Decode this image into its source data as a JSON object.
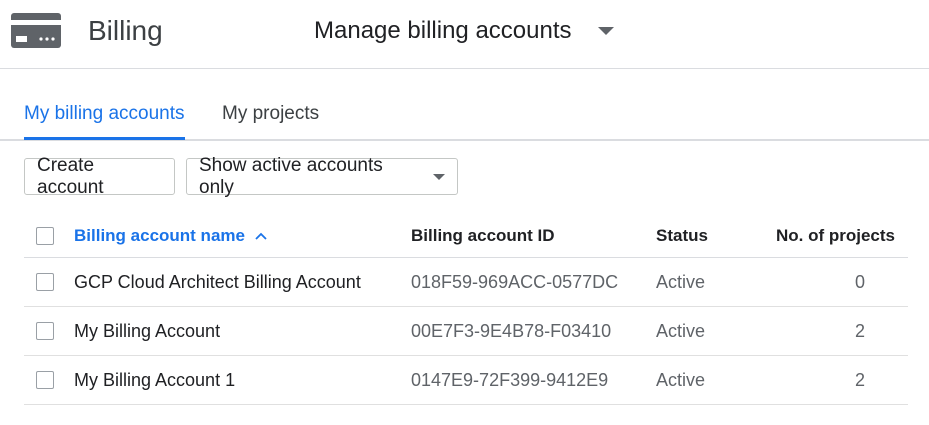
{
  "header": {
    "icon": "billing-card-icon",
    "title": "Billing",
    "account_picker": "Manage billing accounts"
  },
  "tabs": [
    {
      "label": "My billing accounts",
      "active": true
    },
    {
      "label": "My projects",
      "active": false
    }
  ],
  "toolbar": {
    "create_label": "Create account",
    "filter_label": "Show active accounts only"
  },
  "table": {
    "columns": {
      "name": "Billing account name",
      "id": "Billing account ID",
      "status": "Status",
      "projects": "No. of projects"
    },
    "sort": "ascending",
    "rows": [
      {
        "name": "GCP Cloud Architect Billing Account",
        "id": "018F59-969ACC-0577DC",
        "status": "Active",
        "projects": "0"
      },
      {
        "name": "My Billing Account",
        "id": "00E7F3-9E4B78-F03410",
        "status": "Active",
        "projects": "2"
      },
      {
        "name": "My Billing Account 1",
        "id": "0147E9-72F399-9412E9",
        "status": "Active",
        "projects": "2"
      }
    ]
  },
  "colors": {
    "accent": "#1a73e8",
    "icon_dark": "#5f6368",
    "divider": "#dadce0"
  }
}
